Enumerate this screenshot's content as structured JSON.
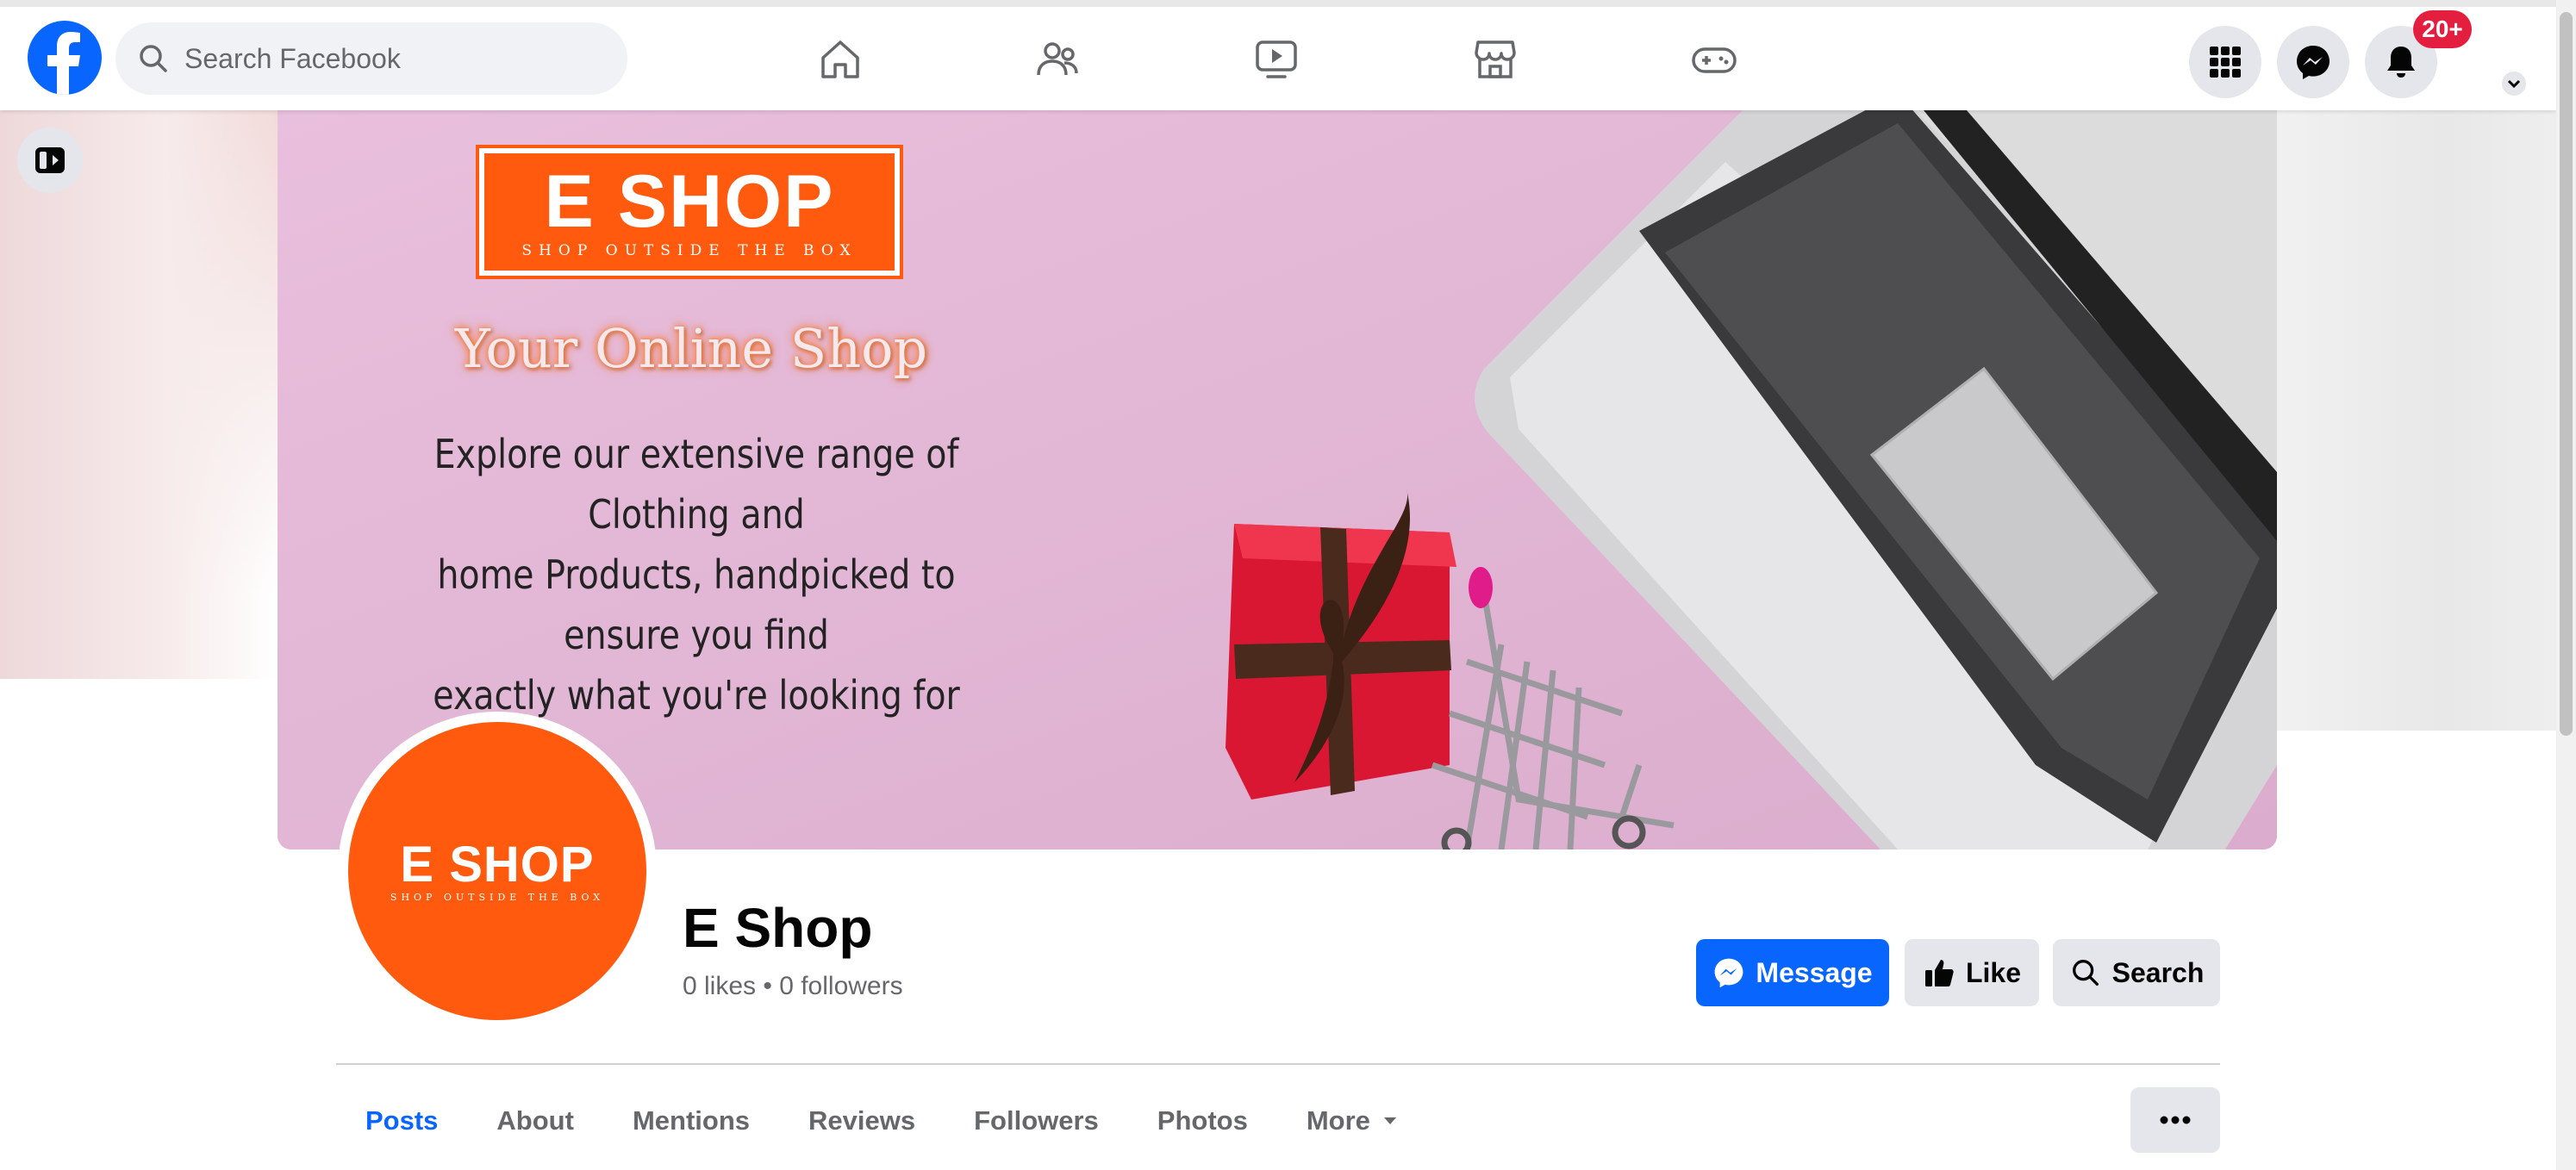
{
  "header": {
    "search_placeholder": "Search Facebook",
    "notification_count": "20+",
    "nav_icons": [
      "home-icon",
      "friends-icon",
      "video-icon",
      "marketplace-icon",
      "gaming-icon"
    ],
    "right_icons": [
      "menu-grid-icon",
      "messenger-icon",
      "bell-icon"
    ]
  },
  "cover": {
    "logo_main": "E SHOP",
    "logo_tagline": "Shop Outside The Box",
    "headline": "Your Online Shop",
    "body_lines": [
      "Explore our extensive range of Clothing and",
      "home Products, handpicked to ensure you find",
      "exactly what you're looking for"
    ]
  },
  "profile": {
    "logo_main": "E SHOP",
    "logo_tagline": "Shop Outside The Box"
  },
  "page": {
    "name": "E Shop",
    "stats": "0 likes • 0 followers"
  },
  "actions": {
    "message": "Message",
    "like": "Like",
    "search": "Search"
  },
  "tabs": [
    {
      "label": "Posts",
      "active": true
    },
    {
      "label": "About"
    },
    {
      "label": "Mentions"
    },
    {
      "label": "Reviews"
    },
    {
      "label": "Followers"
    },
    {
      "label": "Photos"
    },
    {
      "label": "More"
    }
  ],
  "colors": {
    "brand_blue": "#0866ff",
    "shop_orange": "#ff5a0e",
    "badge_red": "#e41e3f",
    "cover_pink": "#e2b7d6"
  }
}
